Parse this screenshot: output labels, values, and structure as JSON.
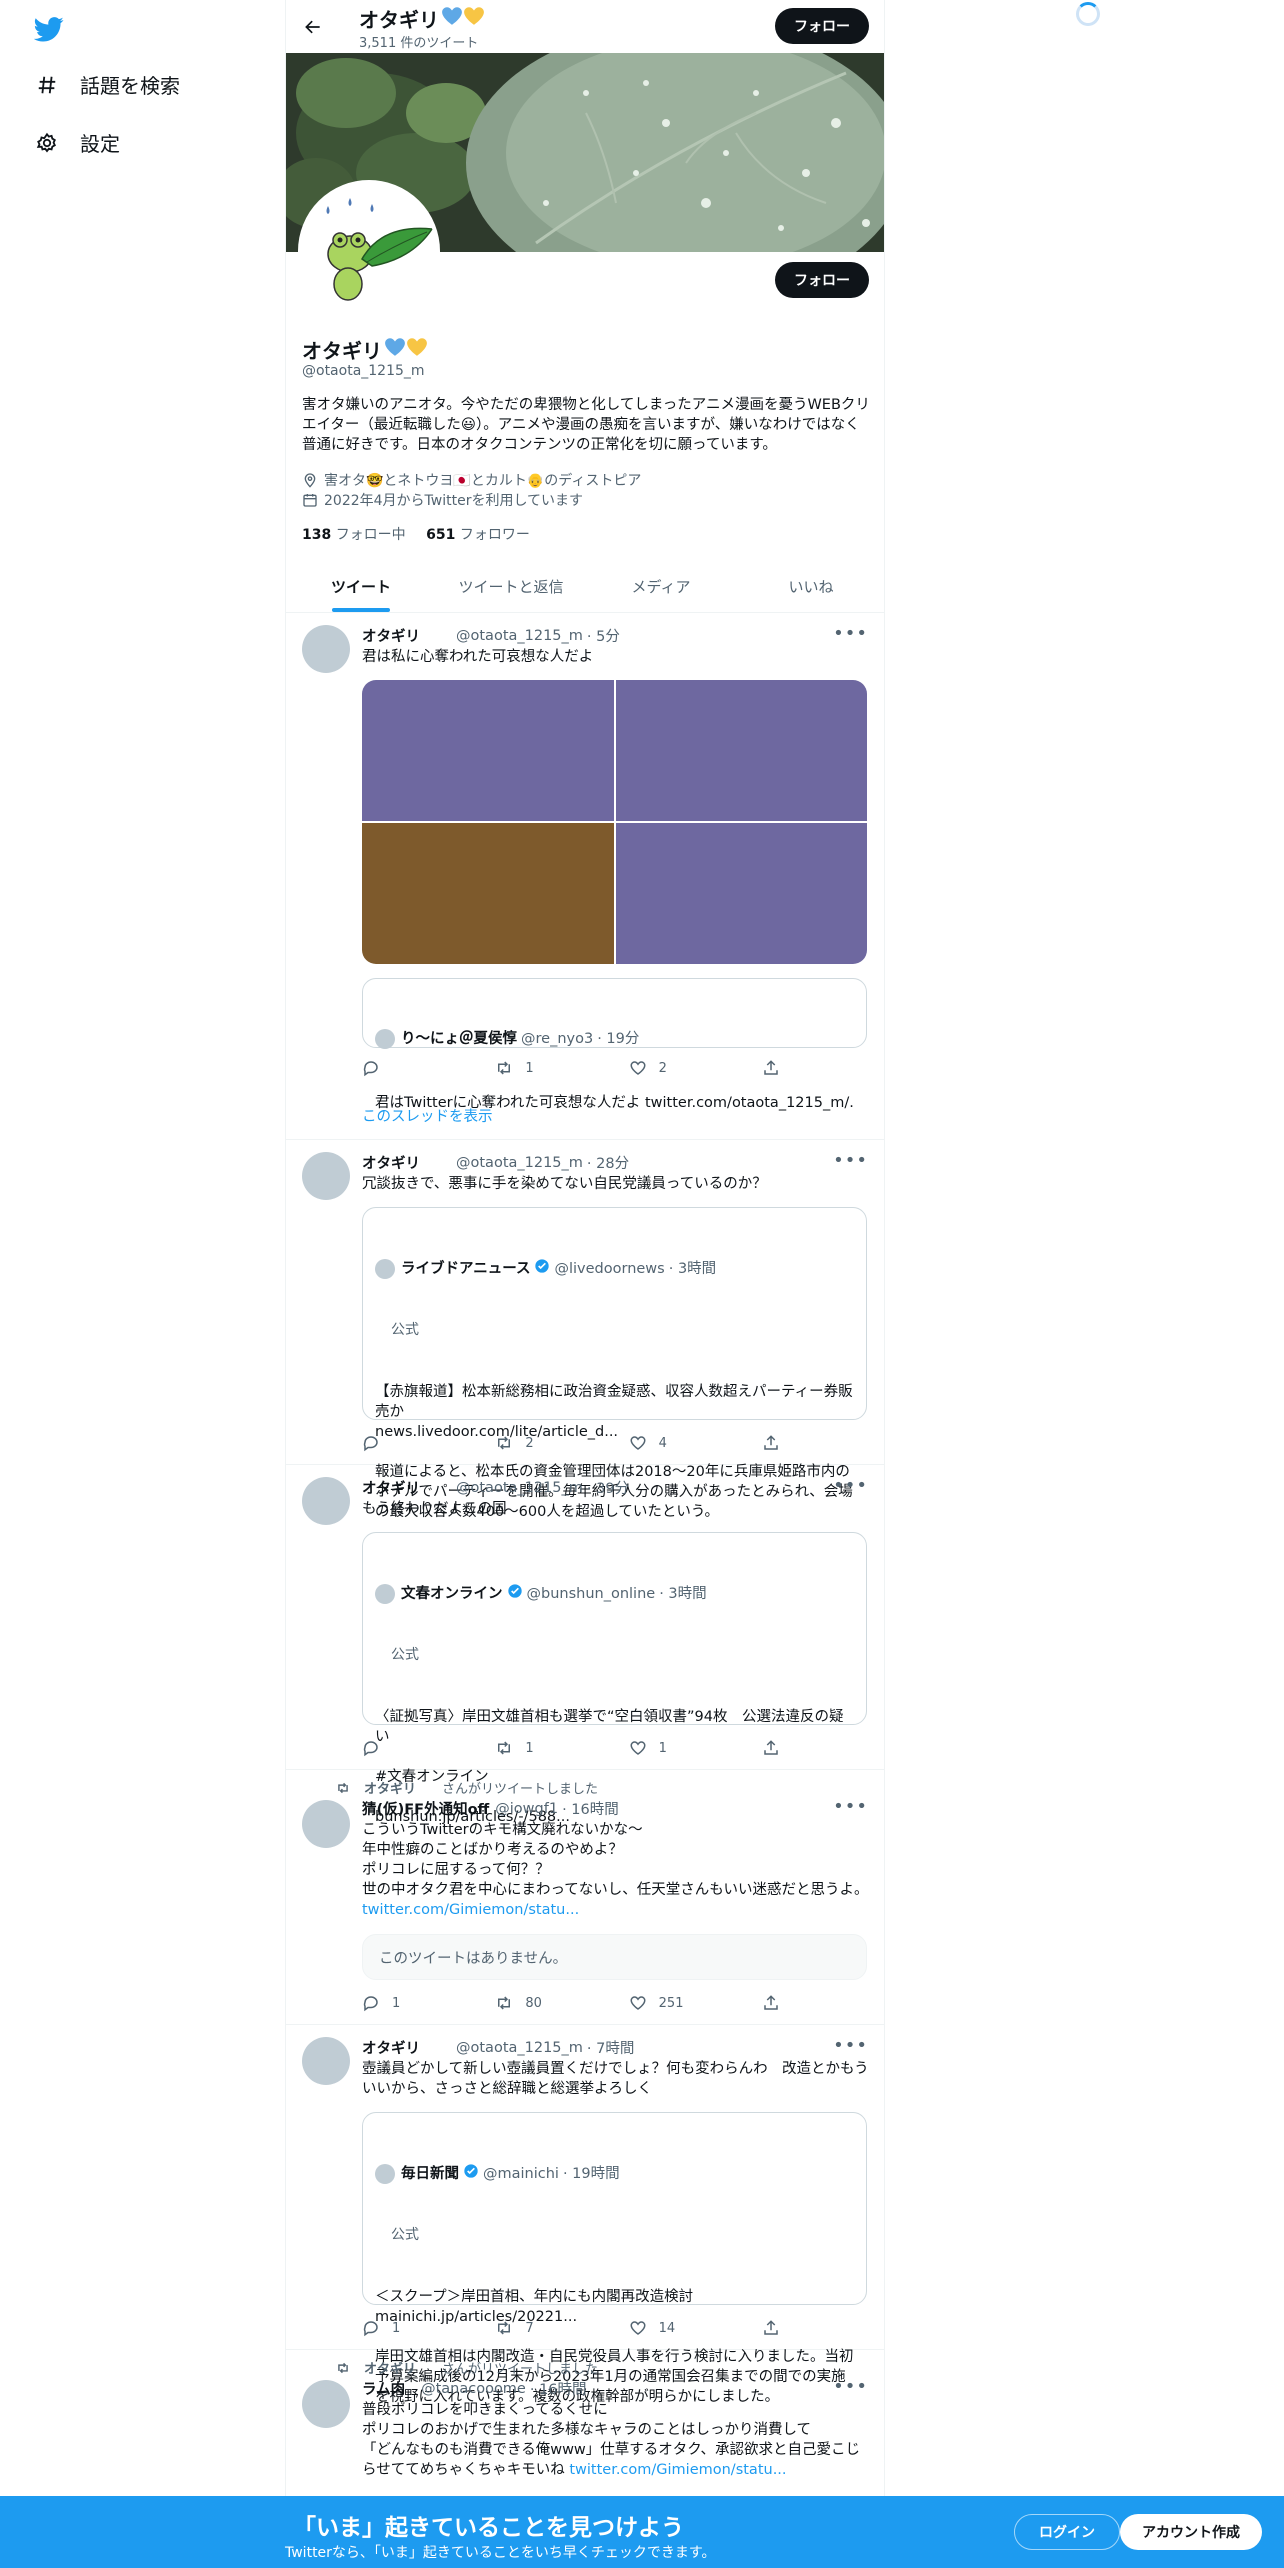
{
  "nav": {
    "explore_label": "話題を検索",
    "settings_label": "設定"
  },
  "header": {
    "name": "オタギリ",
    "tweet_count": "3,511 件のツイート",
    "follow_label": "フォロー"
  },
  "profile": {
    "name": "オタギリ",
    "handle": "@otaota_1215_m",
    "follow_label": "フォロー",
    "bio": "害オタ嫌いのアニオタ。今やただの卑猥物と化してしまったアニメ漫画を憂うWEBクリエイター（最近転職した😃）。アニメや漫画の愚痴を言いますが、嫌いなわけではなく普通に好きです。日本のオタクコンテンツの正常化を切に願っています。",
    "location": "害オタ🤓とネトウヨ🇯🇵とカルト👴のディストピア",
    "joined": "2022年4月からTwitterを利用しています",
    "following_count": "138",
    "following_label": "フォロー中",
    "followers_count": "651",
    "followers_label": "フォロワー"
  },
  "tabs": [
    "ツイート",
    "ツイートと返信",
    "メディア",
    "いいね"
  ],
  "tweets": [
    {
      "name": "オタギリ",
      "handle": "@otaota_1215_m",
      "time": "· 5分",
      "text": "君は私に心奪われた可哀想な人だよ",
      "media_colors": [
        "#6e68a0",
        "#6e68a0",
        "#7e5a2c",
        "#6e68a0"
      ],
      "quote": {
        "name": "り〜にょ＠夏侯惇",
        "handle": "@re_nyo3",
        "time": "· 19分",
        "text": "君はTwitterに心奪われた可哀想な人だよ twitter.com/otaota_1215_m/..."
      },
      "replies": "",
      "retweets": "1",
      "likes": "2",
      "show_thread": "このスレッドを表示"
    },
    {
      "name": "オタギリ",
      "handle": "@otaota_1215_m",
      "time": "· 28分",
      "text": "冗談抜きで、悪事に手を染めてない自民党議員っているのか？",
      "quote": {
        "name": "ライブドアニュース",
        "handle": "@livedoornews",
        "time": "· 3時間",
        "official": "公式",
        "text": "【赤旗報道】松本新総務相に政治資金疑惑、収容人数超えパーティー券販売か\nnews.livedoor.com/lite/article_d...\n\n報道によると、松本氏の資金管理団体は2018～20年に兵庫県姫路市内のホテルでパーティーを開催。毎年約千人分の購入があったとみられ、会場の最大収容人数400～600人を超過していたという。"
      },
      "replies": "",
      "retweets": "2",
      "likes": "4"
    },
    {
      "name": "オタギリ",
      "handle": "@otaota_1215_m",
      "time": "· 39分",
      "text": "もう終わりだよこの国",
      "quote": {
        "name": "文春オンライン",
        "handle": "@bunshun_online",
        "time": "· 3時間",
        "official": "公式",
        "text": "〈証拠写真〉岸田文雄首相も選挙で“空白領収書”94枚　公選法違反の疑い\n\n#文春オンライン\n\nbunshun.jp/articles/-/588..."
      },
      "replies": "",
      "retweets": "1",
      "likes": "1"
    },
    {
      "retweeted_by": "オタギリ",
      "retweeted_label": "さんがリツイートしました",
      "name": "猜(仮)FF外通知off",
      "handle": "@iowgf1",
      "time": "· 16時間",
      "text": "こういうTwitterのキモ構文廃れないかな～\n年中性癖のことばかり考えるのやめよ？\nポリコレに屈するって何？？\n世の中オタク君を中心にまわってないし、任天堂さんもいい迷惑だと思うよ。",
      "link": "twitter.com/Gimiemon/statu...",
      "unavailable": "このツイートはありません。",
      "replies": "1",
      "retweets": "80",
      "likes": "251"
    },
    {
      "name": "オタギリ",
      "handle": "@otaota_1215_m",
      "time": "· 7時間",
      "text": "壺議員どかして新しい壺議員置くだけでしょ？何も変わらんわ　改造とかもういいから、さっさと総辞職と総選挙よろしく",
      "quote": {
        "name": "毎日新聞",
        "handle": "@mainichi",
        "time": "· 19時間",
        "official": "公式",
        "text": "＜スクープ＞岸田首相、年内にも内閣再改造検討\nmainichi.jp/articles/20221...\n\n岸田文雄首相は内閣改造・自民党役員人事を行う検討に入りました。当初予算案編成後の12月末から2023年1月の通常国会召集までの間での実施を視野に入れています。複数の政権幹部が明らかにしました。"
      },
      "replies": "1",
      "retweets": "7",
      "likes": "14"
    },
    {
      "retweeted_by": "オタギリ",
      "retweeted_label": "さんがリツイートしました",
      "name": "ラム肉",
      "handle": "@tanacooome",
      "time": "· 16時間",
      "text": "普段ポリコレを叩きまくってるくせに\nポリコレのおかげで生まれた多様なキャラのことはしっかり消費して\n「どんなものも消費できる俺www」仕草するオタク、承認欲求と自己愛こじらせててめちゃくちゃキモいね",
      "link": "twitter.com/Gimiemon/statu..."
    }
  ],
  "bottom_bar": {
    "title": "「いま」起きていることを見つけよう",
    "subtitle": "Twitterなら、「いま」起きていることをいち早くチェックできます。",
    "login_label": "ログイン",
    "signup_label": "アカウント作成"
  },
  "colors": {
    "accent": "#1d9bf0",
    "text": "#0f1419",
    "secondary": "#536471"
  }
}
